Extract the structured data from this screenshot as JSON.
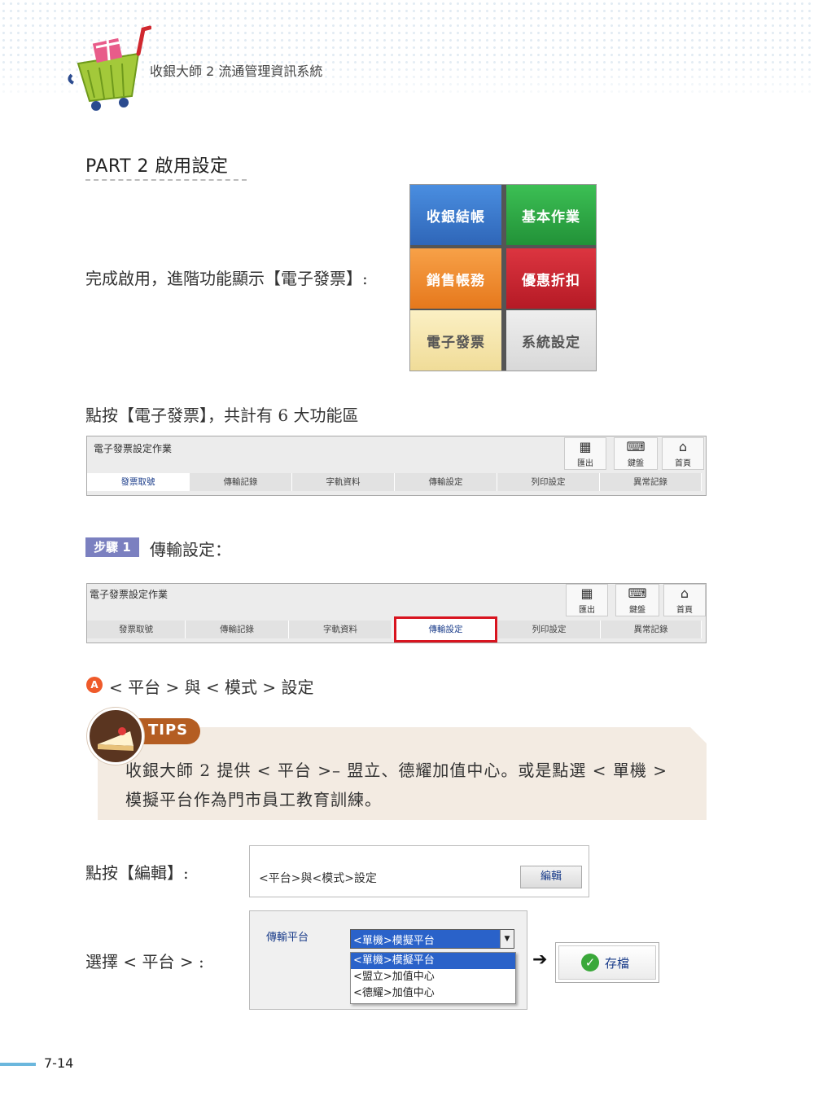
{
  "header": {
    "title": "收銀大師 2 流通管理資訊系統"
  },
  "part_heading": "PART 2  啟用設定",
  "intro_text": "完成啟用，進階功能顯示【電子發票】:",
  "tiles": [
    {
      "label": "收銀結帳",
      "color": "#3f7fcf"
    },
    {
      "label": "基本作業",
      "color": "#2fa945"
    },
    {
      "label": "銷售帳務",
      "color": "#f08a2a"
    },
    {
      "label": "優惠折扣",
      "color": "#c8222e"
    },
    {
      "label": "電子發票",
      "color": "#f6e7b0"
    },
    {
      "label": "系統設定",
      "color": "#e3e3e3"
    }
  ],
  "six_areas_text": "點按【電子發票】，共計有 6 大功能區",
  "toolbar": {
    "title": "電子發票設定作業",
    "buttons": [
      "匯出",
      "鍵盤",
      "首頁"
    ],
    "tabs": [
      "發票取號",
      "傳輸記錄",
      "字軌資料",
      "傳輸設定",
      "列印設定",
      "異常記錄"
    ]
  },
  "step": {
    "badge": "步驟 1",
    "title": "傳輸設定："
  },
  "item_a": {
    "marker": "A",
    "text": "< 平台 > 與 < 模式 > 設定"
  },
  "tips": {
    "label": "TIPS",
    "text": "收銀大師 2 提供 < 平台 >– 盟立、德耀加值中心。或是點選 < 單機 > 模擬平台作為門市員工教育訓練。"
  },
  "click_edit_text": "點按【編輯】:",
  "edit_box": {
    "label": "<平台>與<模式>設定",
    "button": "編輯"
  },
  "choose_platform_text": "選擇 < 平台 > :",
  "platform": {
    "label": "傳輸平台",
    "selected": "<單機>模擬平台",
    "options": [
      "<單機>模擬平台",
      "<盟立>加值中心",
      "<德耀>加值中心"
    ]
  },
  "save_button": "存檔",
  "page_number": "7-14"
}
